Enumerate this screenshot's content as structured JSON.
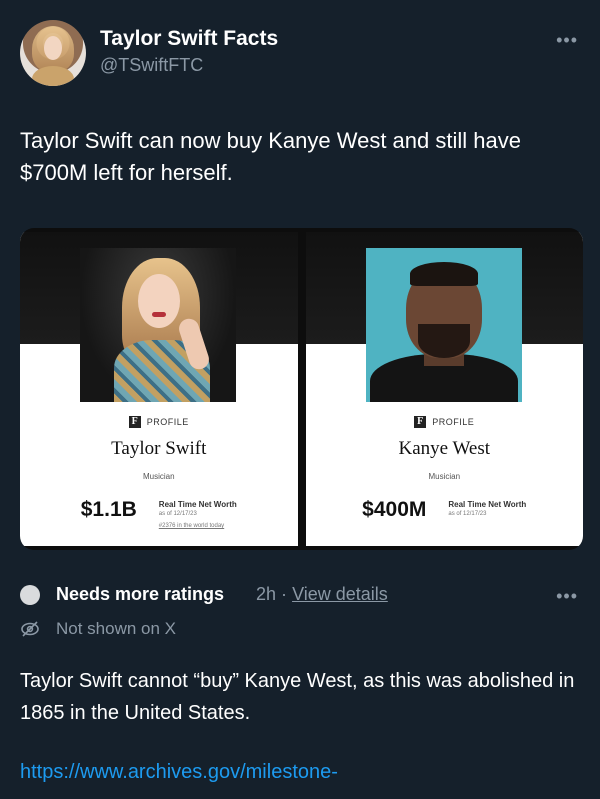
{
  "author": {
    "display_name": "Taylor Swift Facts",
    "handle": "@TSwiftFTC",
    "more_icon": "more-horizontal-icon"
  },
  "tweet": {
    "text": "Taylor Swift can now buy Kanye West and still have $700M left for herself."
  },
  "media": {
    "profiles": [
      {
        "profile_label": "PROFILE",
        "name": "Taylor Swift",
        "role": "Musician",
        "net_worth": "$1.1B",
        "net_worth_label": "Real Time Net Worth",
        "as_of": "as of 12/17/23",
        "rank": "#2376 in the world today"
      },
      {
        "profile_label": "PROFILE",
        "name": "Kanye West",
        "role": "Musician",
        "net_worth": "$400M",
        "net_worth_label": "Real Time Net Worth",
        "as_of": "as of 12/17/23"
      }
    ]
  },
  "note": {
    "status": "Needs more ratings",
    "time": "2h",
    "separator": "·",
    "details_link": "View details",
    "visibility": "Not shown on X",
    "body": "Taylor Swift cannot “buy” Kanye West, as this was abolished in 1865 in the United States.",
    "link": "https://www.archives.gov/milestone-"
  },
  "colors": {
    "background": "#15202b",
    "secondary_text": "#8b98a5",
    "link": "#1d9bf0"
  }
}
